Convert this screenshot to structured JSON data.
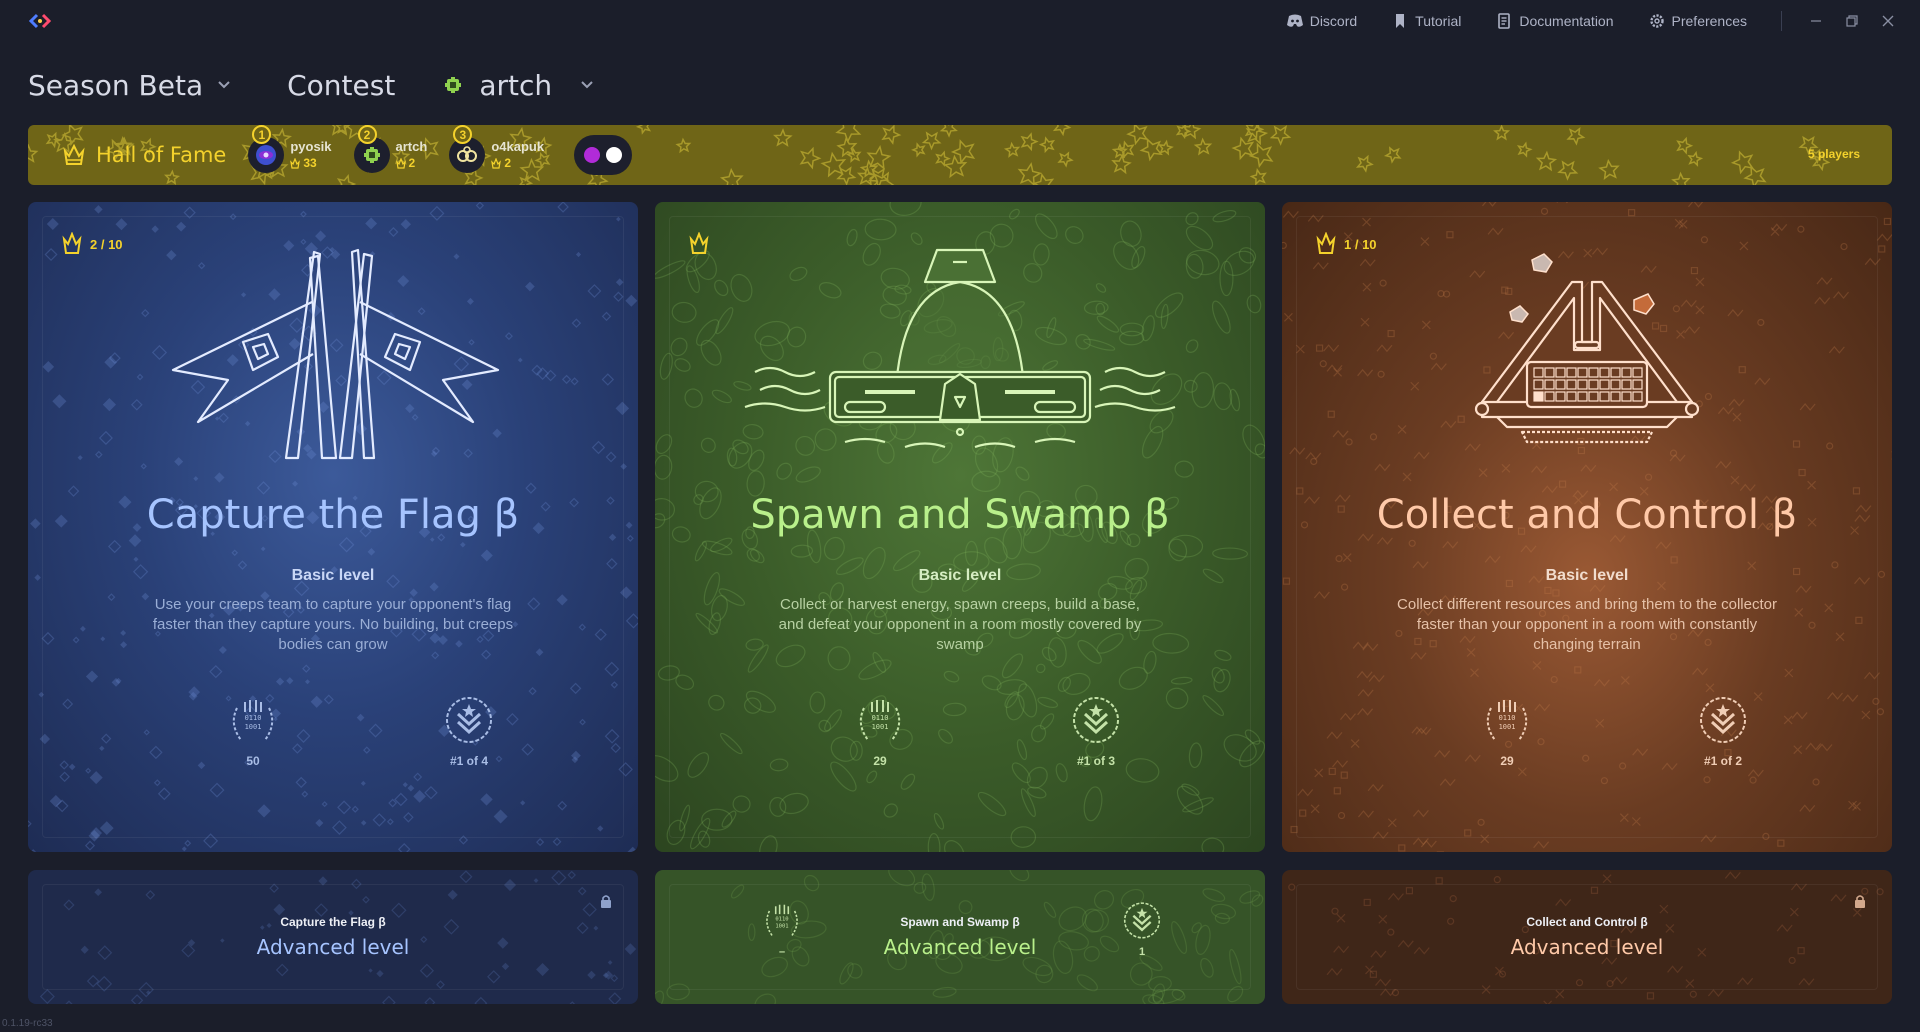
{
  "toolbar": {
    "links": [
      {
        "label": "Discord",
        "icon": "discord-icon"
      },
      {
        "label": "Tutorial",
        "icon": "bookmark-icon"
      },
      {
        "label": "Documentation",
        "icon": "document-icon"
      },
      {
        "label": "Preferences",
        "icon": "gear-icon"
      }
    ]
  },
  "selectors": {
    "season": "Season Beta",
    "contest": "Contest",
    "player": "artch"
  },
  "hall_of_fame": {
    "title": "Hall of Fame",
    "players": [
      {
        "rank": "1",
        "name": "pyosik",
        "score": "33"
      },
      {
        "rank": "2",
        "name": "artch",
        "score": "2"
      },
      {
        "rank": "3",
        "name": "o4kapuk",
        "score": "2"
      }
    ],
    "player_count": "5 players",
    "colors": {
      "bar": "#6f6517",
      "accent": "#f4d22c"
    }
  },
  "cards": [
    {
      "badge": "2 / 10",
      "title": "Capture the Flag β",
      "level": "Basic level",
      "description": "Use your creeps team to capture your opponent's flag faster than they capture yours. No building, but creeps bodies can grow",
      "stats": {
        "left": "50",
        "right": "#1 of 4"
      },
      "color": "#a6c4ff"
    },
    {
      "badge": "",
      "title": "Spawn and Swamp β",
      "level": "Basic level",
      "description": "Collect or harvest energy, spawn creeps, build a base, and defeat your opponent in a room mostly covered by swamp",
      "stats": {
        "left": "29",
        "right": "#1 of 3"
      },
      "color": "#b9f08b"
    },
    {
      "badge": "1 / 10",
      "title": "Collect and Control β",
      "level": "Basic level",
      "description": "Collect different resources and bring them to the collector faster than your opponent in a room with constantly changing terrain",
      "stats": {
        "left": "29",
        "right": "#1 of 2"
      },
      "color": "#ffc9a8"
    }
  ],
  "advanced": [
    {
      "subtitle": "Capture the Flag β",
      "title": "Advanced level",
      "locked": true
    },
    {
      "subtitle": "Spawn and Swamp β",
      "title": "Advanced level",
      "locked": false,
      "stats": {
        "left": "–",
        "right": "1"
      }
    },
    {
      "subtitle": "Collect and Control β",
      "title": "Advanced level",
      "locked": true
    }
  ],
  "version": "0.1.19-rc33"
}
